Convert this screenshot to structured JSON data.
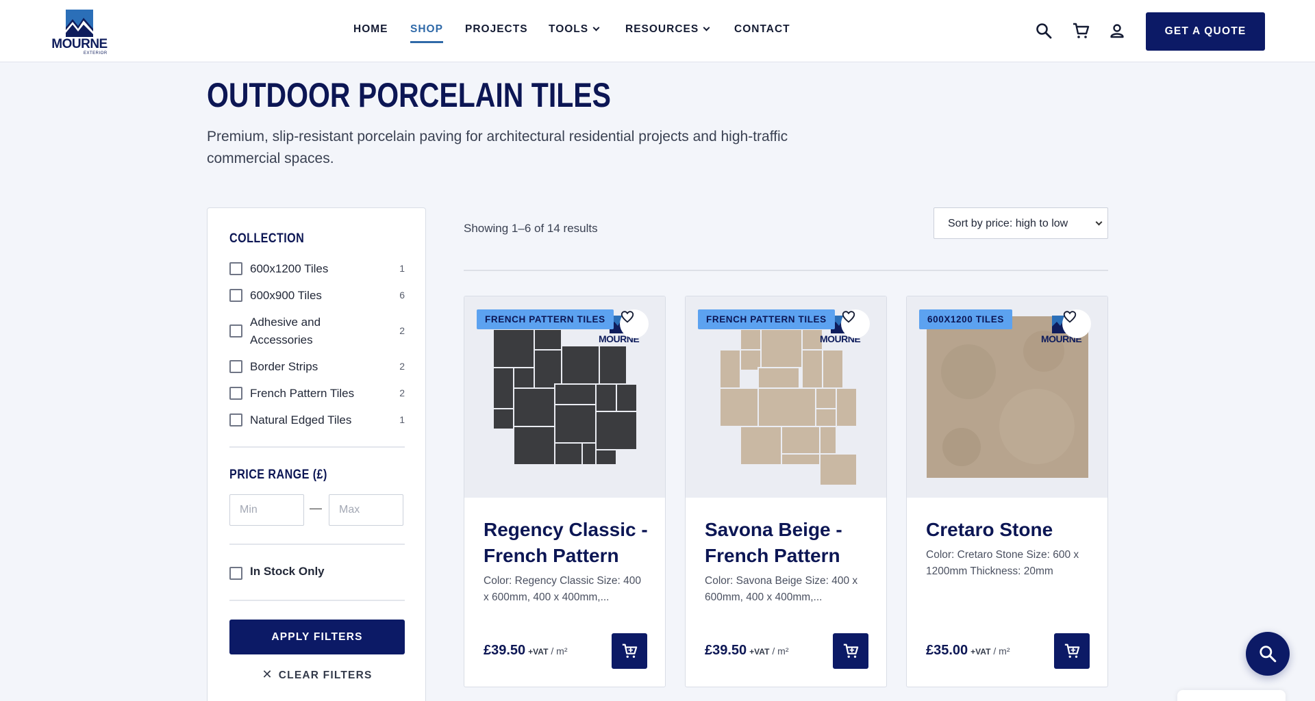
{
  "brand": {
    "name": "MOURNE",
    "sub": "EXTERIOR",
    "color": "#0c1a66"
  },
  "nav": {
    "items": [
      {
        "label": "HOME"
      },
      {
        "label": "SHOP",
        "active": true
      },
      {
        "label": "PROJECTS"
      },
      {
        "label": "TOOLS",
        "dropdown": true
      },
      {
        "label": "RESOURCES",
        "dropdown": true
      },
      {
        "label": "CONTACT"
      }
    ],
    "quote_label": "GET A QUOTE",
    "icons": [
      "search-icon",
      "cart-icon",
      "user-icon"
    ]
  },
  "hero": {
    "title": "OUTDOOR PORCELAIN TILES",
    "subtitle": "Premium, slip-resistant porcelain paving for architectural residential projects and high-traffic commercial spaces."
  },
  "filters": {
    "collection_heading": "COLLECTION",
    "collections": [
      {
        "label": "600x1200 Tiles",
        "count": "1"
      },
      {
        "label": "600x900 Tiles",
        "count": "6"
      },
      {
        "label": "Adhesive and Accessories",
        "count": "2"
      },
      {
        "label": "Border Strips",
        "count": "2"
      },
      {
        "label": "French Pattern Tiles",
        "count": "2"
      },
      {
        "label": "Natural Edged Tiles",
        "count": "1"
      }
    ],
    "price_heading": "PRICE RANGE (£)",
    "min_placeholder": "Min",
    "max_placeholder": "Max",
    "dash": "—",
    "in_stock_label": "In Stock Only",
    "apply_label": "APPLY FILTERS",
    "clear_label": "CLEAR FILTERS"
  },
  "results": {
    "count_text": "Showing 1–6 of 14 results",
    "sort_selected": "Sort by price: high to low"
  },
  "products": [
    {
      "badge": "FRENCH PATTERN TILES",
      "title": "Regency Classic - French Pattern",
      "desc": "Color: Regency Classic Size: 400 x 600mm, 400 x 400mm,...",
      "price": "£39.50",
      "vat": "+VAT",
      "unit": "/ m²",
      "swatch": "#3b3c3f"
    },
    {
      "badge": "FRENCH PATTERN TILES",
      "title": "Savona Beige - French Pattern",
      "desc": "Color: Savona Beige Size: 400 x 600mm, 400 x 400mm,...",
      "price": "£39.50",
      "vat": "+VAT",
      "unit": "/ m²",
      "swatch": "#c9b8a3"
    },
    {
      "badge": "600X1200 TILES",
      "title": "Cretaro Stone",
      "desc": "Color: Cretaro Stone Size: 600 x 1200mm Thickness: 20mm",
      "price": "£35.00",
      "vat": "+VAT",
      "unit": "/ m²",
      "swatch": "#b7a48e"
    }
  ]
}
